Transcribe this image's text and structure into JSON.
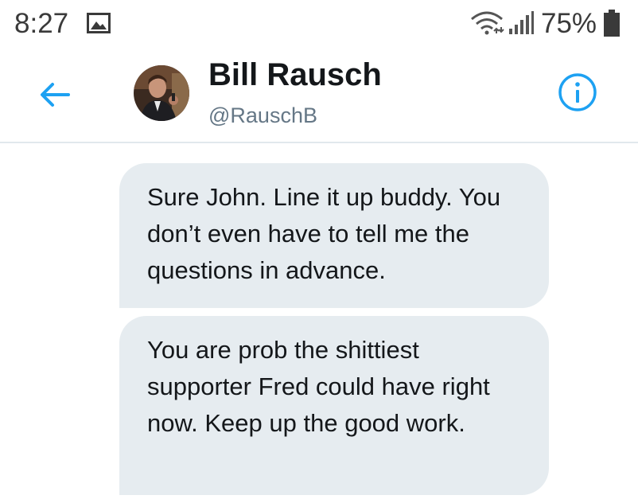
{
  "status_bar": {
    "time": "8:27",
    "battery": "75%",
    "icons": [
      "gallery-icon",
      "wifi-icon",
      "signal-icon",
      "battery-icon"
    ]
  },
  "header": {
    "name": "Bill Rausch",
    "handle": "@RauschB",
    "back_icon": "arrow-left-icon",
    "info_icon": "info-icon",
    "accent_color": "#1da1f2"
  },
  "messages": [
    {
      "text": "Sure John. Line it up buddy. You don’t even have to tell me the questions in advance."
    },
    {
      "text": "You are prob the shittiest supporter Fred could have right now. Keep up the good work."
    }
  ]
}
